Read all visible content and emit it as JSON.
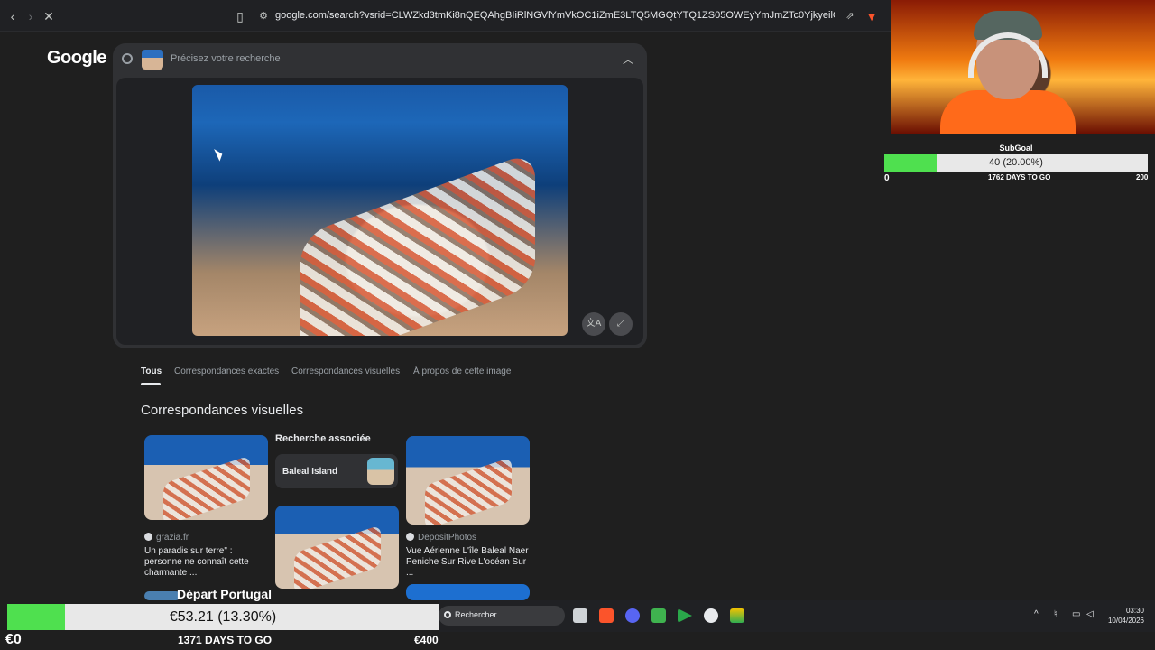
{
  "browser": {
    "url": "google.com/search?vsrid=CLWZkd3tmKi8nQEQAhgBIiRlNGVlYmVkOC1iZmE3LTQ5MGQtYTQ1ZS05OWEyYmJmZTc0YjkyeilCcmQoGklyCi5sZmUtZHVt..."
  },
  "google": {
    "logo": "Google",
    "search_placeholder": "Précisez votre recherche"
  },
  "tabs": [
    {
      "label": "Tous",
      "active": true
    },
    {
      "label": "Correspondances exactes",
      "active": false
    },
    {
      "label": "Correspondances visuelles",
      "active": false
    },
    {
      "label": "À propos de cette image",
      "active": false
    }
  ],
  "results": {
    "section_title": "Correspondances visuelles",
    "related_title": "Recherche associée",
    "related_chip": "Baleal Island",
    "cards": [
      {
        "source": "grazia.fr",
        "desc": "Un paradis sur terre\" : personne ne connaît cette charmante ..."
      },
      {
        "source": "DepositPhotos",
        "desc": "Vue Aérienne L'île Baleal Naer Peniche Sur Rive L'océan Sur ..."
      }
    ],
    "depart_label": "Départ Portugal"
  },
  "overlay": {
    "subgoal_label": "SubGoal",
    "subgoal_text": "40 (20.00%)",
    "subgoal_fraction": 0.2,
    "subgoal_min": "0",
    "subgoal_days": "1762 DAYS TO GO",
    "subgoal_max": "200",
    "goal_text": "€53.21 (13.30%)",
    "goal_fraction": 0.133,
    "goal_min": "€0",
    "goal_days": "1371 DAYS TO GO",
    "goal_max": "€400"
  },
  "taskbar": {
    "search_text": "Rechercher",
    "time": "03:30",
    "date": "10/04/2026"
  },
  "colors": {
    "background": "#1f1f1f",
    "progress_fill": "#4fe04f"
  }
}
